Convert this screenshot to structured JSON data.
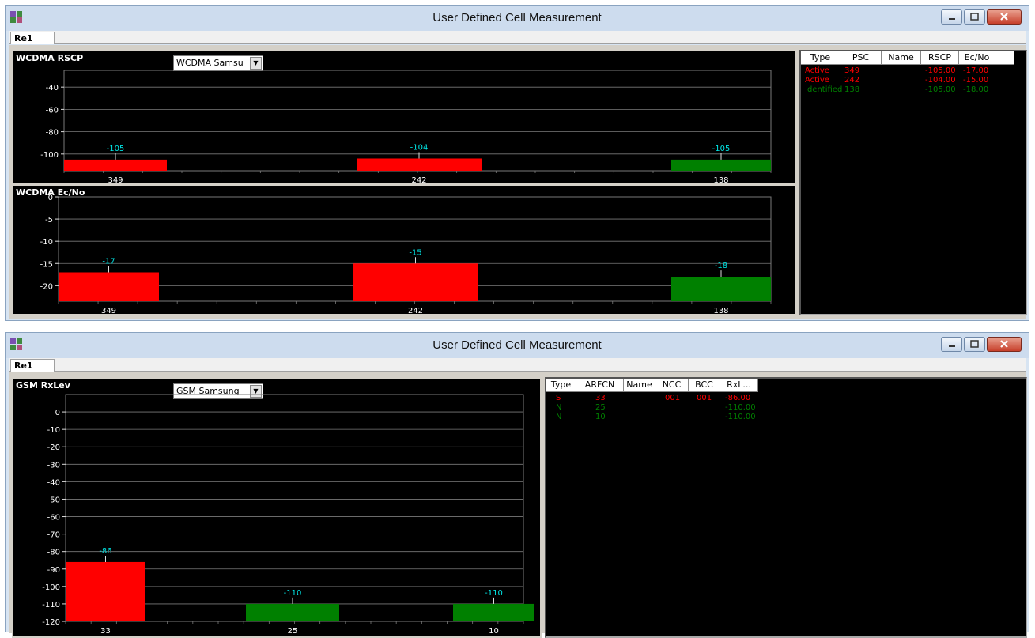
{
  "colors": {
    "active": "#ff0000",
    "identified": "#008000",
    "label": "#00e5e5",
    "grid": "#7a7a7a"
  },
  "windows": [
    {
      "title": "User Defined Cell Measurement",
      "tab": "Re1",
      "panels": [
        {
          "title": "WCDMA RSCP",
          "combo": "WCDMA Samsu"
        },
        {
          "title": "WCDMA Ec/No"
        }
      ],
      "table": {
        "headers": [
          "Type",
          "PSC",
          "Name",
          "RSCP",
          "Ec/No"
        ],
        "rows": [
          {
            "type": "Active",
            "psc": "349",
            "name": "",
            "rscp": "-105.00",
            "ecno": "-17.00",
            "color": "#ff0000"
          },
          {
            "type": "Active",
            "psc": "242",
            "name": "",
            "rscp": "-104.00",
            "ecno": "-15.00",
            "color": "#ff0000"
          },
          {
            "type": "Identified",
            "psc": "138",
            "name": "",
            "rscp": "-105.00",
            "ecno": "-18.00",
            "color": "#008000"
          }
        ]
      }
    },
    {
      "title": "User Defined Cell Measurement",
      "tab": "Re1",
      "panels": [
        {
          "title": "GSM RxLev",
          "combo": "GSM Samsung"
        }
      ],
      "table": {
        "headers": [
          "Type",
          "ARFCN",
          "Name",
          "NCC",
          "BCC",
          "RxL..."
        ],
        "rows": [
          {
            "type": "S",
            "arfcn": "33",
            "name": "",
            "ncc": "001",
            "bcc": "001",
            "rxl": "-86.00",
            "color": "#ff0000"
          },
          {
            "type": "N",
            "arfcn": "25",
            "name": "",
            "ncc": "",
            "bcc": "",
            "rxl": "-110.00",
            "color": "#008000"
          },
          {
            "type": "N",
            "arfcn": "10",
            "name": "",
            "ncc": "",
            "bcc": "",
            "rxl": "-110.00",
            "color": "#008000"
          }
        ]
      }
    }
  ],
  "chart_data": [
    {
      "type": "bar",
      "title": "WCDMA RSCP",
      "categories": [
        "349",
        "242",
        "138"
      ],
      "values": [
        -105,
        -104,
        -105
      ],
      "labels": [
        "-105",
        "-104",
        "-105"
      ],
      "colors": [
        "#ff0000",
        "#ff0000",
        "#008000"
      ],
      "yticks": [
        -40,
        -60,
        -80,
        -100
      ],
      "ylim": [
        -115,
        -25
      ]
    },
    {
      "type": "bar",
      "title": "WCDMA Ec/No",
      "categories": [
        "349",
        "242",
        "138"
      ],
      "values": [
        -17,
        -15,
        -18
      ],
      "labels": [
        "-17",
        "-15",
        "-18"
      ],
      "colors": [
        "#ff0000",
        "#ff0000",
        "#008000"
      ],
      "yticks": [
        0,
        -5,
        -10,
        -15,
        -20
      ],
      "ylim": [
        -23.5,
        0
      ]
    },
    {
      "type": "bar",
      "title": "GSM RxLev",
      "categories": [
        "33",
        "25",
        "10"
      ],
      "values": [
        -86,
        -110,
        -110
      ],
      "labels": [
        "-86",
        "-110",
        "-110"
      ],
      "colors": [
        "#ff0000",
        "#008000",
        "#008000"
      ],
      "yticks": [
        0,
        -10,
        -20,
        -30,
        -40,
        -50,
        -60,
        -70,
        -80,
        -90,
        -100,
        -110,
        -120
      ],
      "ylim": [
        -120,
        10
      ]
    }
  ]
}
